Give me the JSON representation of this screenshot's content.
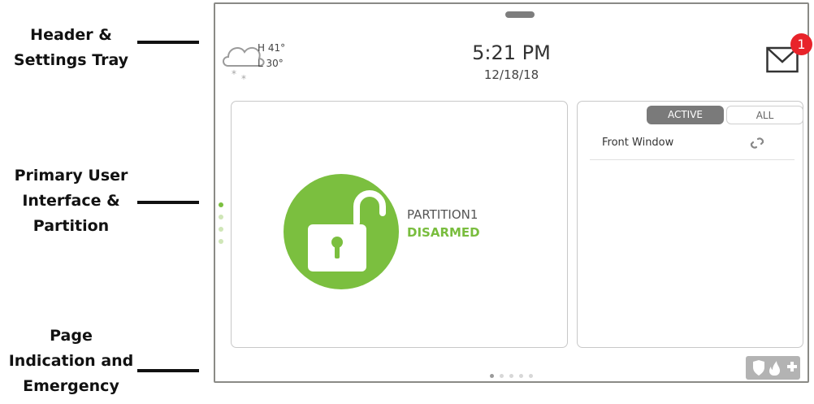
{
  "annotations": {
    "header": [
      "Header &",
      "Settings Tray"
    ],
    "primary": [
      "Primary User",
      "Interface &",
      "Partition"
    ],
    "page": [
      "Page",
      "Indication and",
      "Emergency"
    ]
  },
  "header": {
    "weather_icon": "cloud-snow-icon",
    "high": "H 41°",
    "low": "L 30°",
    "time": "5:21 PM",
    "date": "12/18/18",
    "mail_icon": "envelope-icon",
    "notification_count": "1"
  },
  "partition": {
    "name": "PARTITION1",
    "status": "DISARMED",
    "lock_icon": "unlocked-padlock-icon",
    "status_color": "#79bd3e"
  },
  "sensors": {
    "tabs": [
      "ACTIVE",
      "ALL"
    ],
    "items": [
      {
        "name": "Front Window",
        "icon": "broken-link-icon"
      }
    ]
  },
  "emergency": {
    "icons": [
      "shield-icon",
      "fire-icon",
      "medical-cross-icon"
    ]
  }
}
